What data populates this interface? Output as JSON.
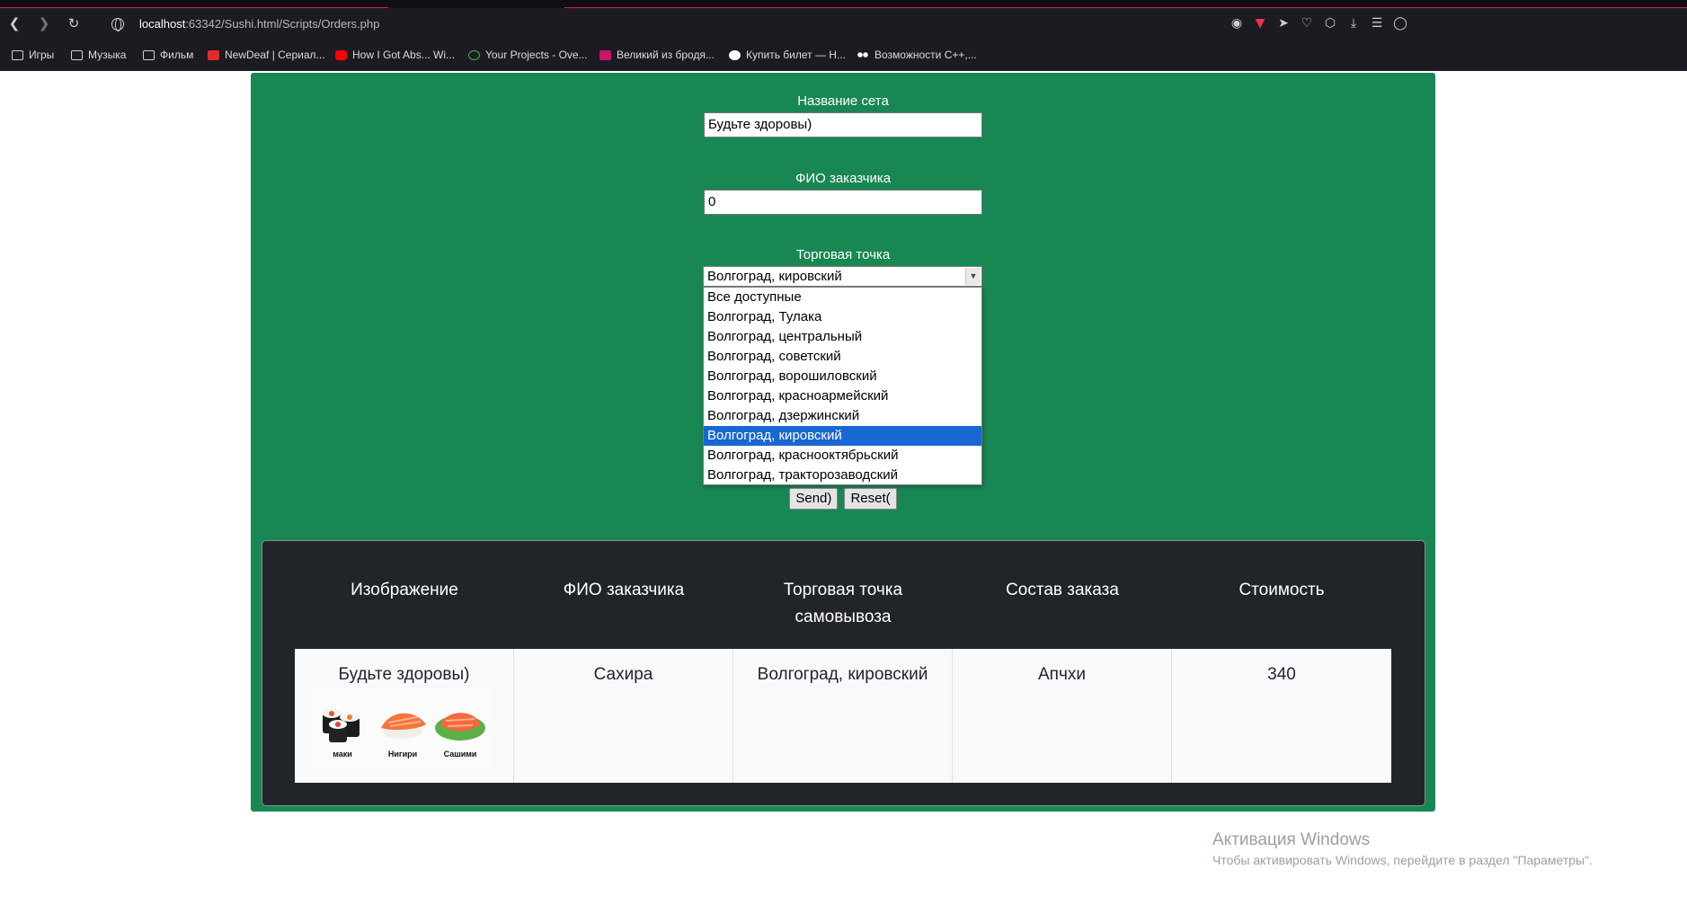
{
  "browser": {
    "url_host": "localhost",
    "url_path": ":63342/Sushi.html/Scripts/Orders.php",
    "bookmarks": [
      {
        "label": "Игры",
        "icon": "folder-icon"
      },
      {
        "label": "Музыка",
        "icon": "folder-icon"
      },
      {
        "label": "Фильм",
        "icon": "folder-icon"
      },
      {
        "label": "NewDeaf | Сериал...",
        "icon": "newdeaf-icon"
      },
      {
        "label": "How I Got Abs... Wi...",
        "icon": "youtube-icon"
      },
      {
        "label": "Your Projects - Ove...",
        "icon": "overleaf-icon"
      },
      {
        "label": "Великий из бродя...",
        "icon": "anime-icon"
      },
      {
        "label": "Купить билет — Н...",
        "icon": "h-icon"
      },
      {
        "label": "Возможности С++,...",
        "icon": "dots-icon"
      }
    ]
  },
  "form": {
    "set_label": "Название сета",
    "set_value": "Будьте здоровы)",
    "customer_label": "ФИО заказчика",
    "customer_value": "0",
    "point_label": "Торговая точка",
    "point_selected": "Волгоград, кировский",
    "point_options": [
      "Все доступные",
      "Волгоград, Тулака",
      "Волгоград, центральный",
      "Волгоград, советский",
      "Волгоград, ворошиловский",
      "Волгоград, красноармейский",
      "Волгоград, дзержинский",
      "Волгоград, кировский",
      "Волгоград, краснооктябрьский",
      "Волгоград, тракторозаводский"
    ],
    "send_label": "Send)",
    "reset_label": "Reset("
  },
  "table": {
    "headers": [
      "Изображение",
      "ФИО заказчика",
      "Торговая точка самовывоза",
      "Состав заказа",
      "Стоимость"
    ],
    "row": {
      "set_name": "Будьте здоровы)",
      "customer": "Сахира",
      "point": "Волгоград, кировский",
      "composition": "Апчхи",
      "price": "340"
    },
    "image_labels": [
      "маки",
      "Нигири",
      "Сашими"
    ]
  },
  "watermark": {
    "title": "Активация Windows",
    "subtitle": "Чтобы активировать Windows, перейдите в раздел \"Параметры\"."
  },
  "colors": {
    "panel": "#198754",
    "table_bg": "#212529",
    "selected_option": "#1967d2"
  }
}
